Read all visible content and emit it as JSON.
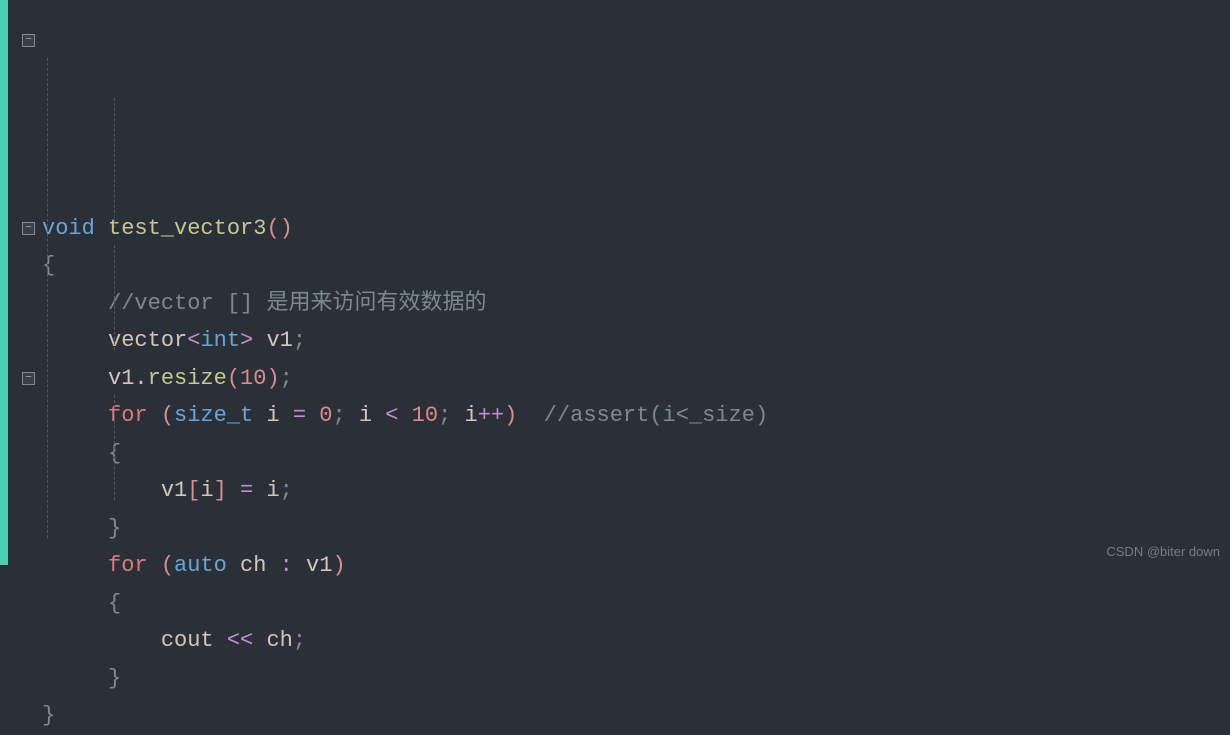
{
  "code": {
    "line1_kw1": "void",
    "line1_fn": "test_vector3",
    "line1_paren": "()",
    "open_brace": "{",
    "line3_comment": "//vector [] 是用来访问有效数据的",
    "line4_type": "vector",
    "line4_angle_open": "<",
    "line4_int": "int",
    "line4_angle_close": ">",
    "line4_var": " v1",
    "line4_semi": ";",
    "line5_var": "v1",
    "line5_dot": ".",
    "line5_fn": "resize",
    "line5_paren_open": "(",
    "line5_num": "10",
    "line5_paren_close": ")",
    "line5_semi": ";",
    "line6_for": "for",
    "line6_paren_open": " (",
    "line6_type": "size_t",
    "line6_var": " i ",
    "line6_eq": "=",
    "line6_zero": " 0",
    "line6_semi1": "; ",
    "line6_var2": "i ",
    "line6_lt": "<",
    "line6_ten": " 10",
    "line6_semi2": "; ",
    "line6_var3": "i",
    "line6_inc": "++",
    "line6_paren_close": ")",
    "line6_comment": "  //assert(i<_size)",
    "line8_arr": "v1",
    "line8_bracket_open": "[",
    "line8_idx": "i",
    "line8_bracket_close": "] ",
    "line8_eq": "=",
    "line8_val": " i",
    "line8_semi": ";",
    "close_brace": "}",
    "line10_for": "for",
    "line10_paren_open": " (",
    "line10_auto": "auto",
    "line10_var": " ch ",
    "line10_colon": ":",
    "line10_var2": " v1",
    "line10_paren_close": ")",
    "line12_cout": "cout ",
    "line12_op": "<<",
    "line12_var": " ch",
    "line12_semi": ";"
  },
  "fold_symbol": "−",
  "watermark": "CSDN @biter down"
}
